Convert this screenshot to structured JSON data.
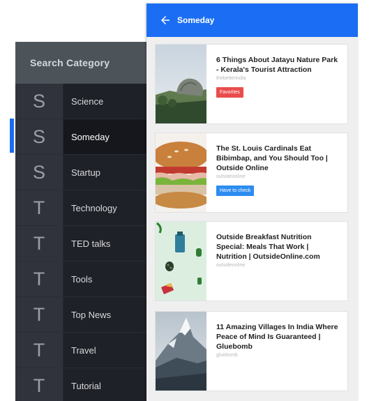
{
  "drawer": {
    "header": "Search Category",
    "items": [
      {
        "letter": "S",
        "label": "Science"
      },
      {
        "letter": "S",
        "label": "Someday"
      },
      {
        "letter": "S",
        "label": "Startup"
      },
      {
        "letter": "T",
        "label": "Technology"
      },
      {
        "letter": "T",
        "label": "TED talks"
      },
      {
        "letter": "T",
        "label": "Tools"
      },
      {
        "letter": "T",
        "label": "Top News"
      },
      {
        "letter": "T",
        "label": "Travel"
      },
      {
        "letter": "T",
        "label": "Tutorial"
      }
    ],
    "active_index": 1
  },
  "appbar": {
    "title": "Someday",
    "back_icon": "arrow-left-icon"
  },
  "cards": [
    {
      "title": "6 Things About Jatayu Nature Park - Kerala's Tourist Attraction",
      "source": "thebetterindia",
      "badge": "Favorites",
      "badge_color": "#ea4c4c"
    },
    {
      "title": "The St. Louis Cardinals Eat Bibimbap, and You Should Too | Outside Online",
      "source": "outsideonline",
      "badge": "Have to check",
      "badge_color": "#2d8cf0"
    },
    {
      "title": "Outside Breakfast Nutrition Special: Meals That Work | Nutrition | OutsideOnline.com",
      "source": "outsideonline"
    },
    {
      "title": "11 Amazing Villages In India Where Peace of Mind Is Guaranteed | Gluebomb",
      "source": "gluebomb"
    }
  ],
  "colors": {
    "accent": "#1b6ef3",
    "drawer_bg": "#1f2128",
    "drawer_header": "#4d5459"
  }
}
